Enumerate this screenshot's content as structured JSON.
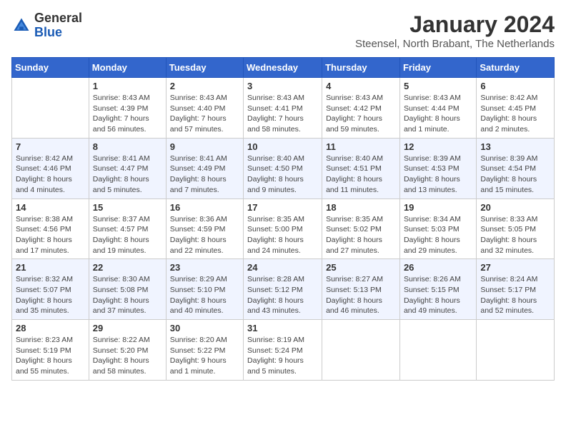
{
  "header": {
    "logo_general": "General",
    "logo_blue": "Blue",
    "calendar_title": "January 2024",
    "calendar_subtitle": "Steensel, North Brabant, The Netherlands"
  },
  "weekdays": [
    "Sunday",
    "Monday",
    "Tuesday",
    "Wednesday",
    "Thursday",
    "Friday",
    "Saturday"
  ],
  "weeks": [
    [
      {
        "day": "",
        "sunrise": "",
        "sunset": "",
        "daylight": ""
      },
      {
        "day": "1",
        "sunrise": "Sunrise: 8:43 AM",
        "sunset": "Sunset: 4:39 PM",
        "daylight": "Daylight: 7 hours and 56 minutes."
      },
      {
        "day": "2",
        "sunrise": "Sunrise: 8:43 AM",
        "sunset": "Sunset: 4:40 PM",
        "daylight": "Daylight: 7 hours and 57 minutes."
      },
      {
        "day": "3",
        "sunrise": "Sunrise: 8:43 AM",
        "sunset": "Sunset: 4:41 PM",
        "daylight": "Daylight: 7 hours and 58 minutes."
      },
      {
        "day": "4",
        "sunrise": "Sunrise: 8:43 AM",
        "sunset": "Sunset: 4:42 PM",
        "daylight": "Daylight: 7 hours and 59 minutes."
      },
      {
        "day": "5",
        "sunrise": "Sunrise: 8:43 AM",
        "sunset": "Sunset: 4:44 PM",
        "daylight": "Daylight: 8 hours and 1 minute."
      },
      {
        "day": "6",
        "sunrise": "Sunrise: 8:42 AM",
        "sunset": "Sunset: 4:45 PM",
        "daylight": "Daylight: 8 hours and 2 minutes."
      }
    ],
    [
      {
        "day": "7",
        "sunrise": "Sunrise: 8:42 AM",
        "sunset": "Sunset: 4:46 PM",
        "daylight": "Daylight: 8 hours and 4 minutes."
      },
      {
        "day": "8",
        "sunrise": "Sunrise: 8:41 AM",
        "sunset": "Sunset: 4:47 PM",
        "daylight": "Daylight: 8 hours and 5 minutes."
      },
      {
        "day": "9",
        "sunrise": "Sunrise: 8:41 AM",
        "sunset": "Sunset: 4:49 PM",
        "daylight": "Daylight: 8 hours and 7 minutes."
      },
      {
        "day": "10",
        "sunrise": "Sunrise: 8:40 AM",
        "sunset": "Sunset: 4:50 PM",
        "daylight": "Daylight: 8 hours and 9 minutes."
      },
      {
        "day": "11",
        "sunrise": "Sunrise: 8:40 AM",
        "sunset": "Sunset: 4:51 PM",
        "daylight": "Daylight: 8 hours and 11 minutes."
      },
      {
        "day": "12",
        "sunrise": "Sunrise: 8:39 AM",
        "sunset": "Sunset: 4:53 PM",
        "daylight": "Daylight: 8 hours and 13 minutes."
      },
      {
        "day": "13",
        "sunrise": "Sunrise: 8:39 AM",
        "sunset": "Sunset: 4:54 PM",
        "daylight": "Daylight: 8 hours and 15 minutes."
      }
    ],
    [
      {
        "day": "14",
        "sunrise": "Sunrise: 8:38 AM",
        "sunset": "Sunset: 4:56 PM",
        "daylight": "Daylight: 8 hours and 17 minutes."
      },
      {
        "day": "15",
        "sunrise": "Sunrise: 8:37 AM",
        "sunset": "Sunset: 4:57 PM",
        "daylight": "Daylight: 8 hours and 19 minutes."
      },
      {
        "day": "16",
        "sunrise": "Sunrise: 8:36 AM",
        "sunset": "Sunset: 4:59 PM",
        "daylight": "Daylight: 8 hours and 22 minutes."
      },
      {
        "day": "17",
        "sunrise": "Sunrise: 8:35 AM",
        "sunset": "Sunset: 5:00 PM",
        "daylight": "Daylight: 8 hours and 24 minutes."
      },
      {
        "day": "18",
        "sunrise": "Sunrise: 8:35 AM",
        "sunset": "Sunset: 5:02 PM",
        "daylight": "Daylight: 8 hours and 27 minutes."
      },
      {
        "day": "19",
        "sunrise": "Sunrise: 8:34 AM",
        "sunset": "Sunset: 5:03 PM",
        "daylight": "Daylight: 8 hours and 29 minutes."
      },
      {
        "day": "20",
        "sunrise": "Sunrise: 8:33 AM",
        "sunset": "Sunset: 5:05 PM",
        "daylight": "Daylight: 8 hours and 32 minutes."
      }
    ],
    [
      {
        "day": "21",
        "sunrise": "Sunrise: 8:32 AM",
        "sunset": "Sunset: 5:07 PM",
        "daylight": "Daylight: 8 hours and 35 minutes."
      },
      {
        "day": "22",
        "sunrise": "Sunrise: 8:30 AM",
        "sunset": "Sunset: 5:08 PM",
        "daylight": "Daylight: 8 hours and 37 minutes."
      },
      {
        "day": "23",
        "sunrise": "Sunrise: 8:29 AM",
        "sunset": "Sunset: 5:10 PM",
        "daylight": "Daylight: 8 hours and 40 minutes."
      },
      {
        "day": "24",
        "sunrise": "Sunrise: 8:28 AM",
        "sunset": "Sunset: 5:12 PM",
        "daylight": "Daylight: 8 hours and 43 minutes."
      },
      {
        "day": "25",
        "sunrise": "Sunrise: 8:27 AM",
        "sunset": "Sunset: 5:13 PM",
        "daylight": "Daylight: 8 hours and 46 minutes."
      },
      {
        "day": "26",
        "sunrise": "Sunrise: 8:26 AM",
        "sunset": "Sunset: 5:15 PM",
        "daylight": "Daylight: 8 hours and 49 minutes."
      },
      {
        "day": "27",
        "sunrise": "Sunrise: 8:24 AM",
        "sunset": "Sunset: 5:17 PM",
        "daylight": "Daylight: 8 hours and 52 minutes."
      }
    ],
    [
      {
        "day": "28",
        "sunrise": "Sunrise: 8:23 AM",
        "sunset": "Sunset: 5:19 PM",
        "daylight": "Daylight: 8 hours and 55 minutes."
      },
      {
        "day": "29",
        "sunrise": "Sunrise: 8:22 AM",
        "sunset": "Sunset: 5:20 PM",
        "daylight": "Daylight: 8 hours and 58 minutes."
      },
      {
        "day": "30",
        "sunrise": "Sunrise: 8:20 AM",
        "sunset": "Sunset: 5:22 PM",
        "daylight": "Daylight: 9 hours and 1 minute."
      },
      {
        "day": "31",
        "sunrise": "Sunrise: 8:19 AM",
        "sunset": "Sunset: 5:24 PM",
        "daylight": "Daylight: 9 hours and 5 minutes."
      },
      {
        "day": "",
        "sunrise": "",
        "sunset": "",
        "daylight": ""
      },
      {
        "day": "",
        "sunrise": "",
        "sunset": "",
        "daylight": ""
      },
      {
        "day": "",
        "sunrise": "",
        "sunset": "",
        "daylight": ""
      }
    ]
  ]
}
